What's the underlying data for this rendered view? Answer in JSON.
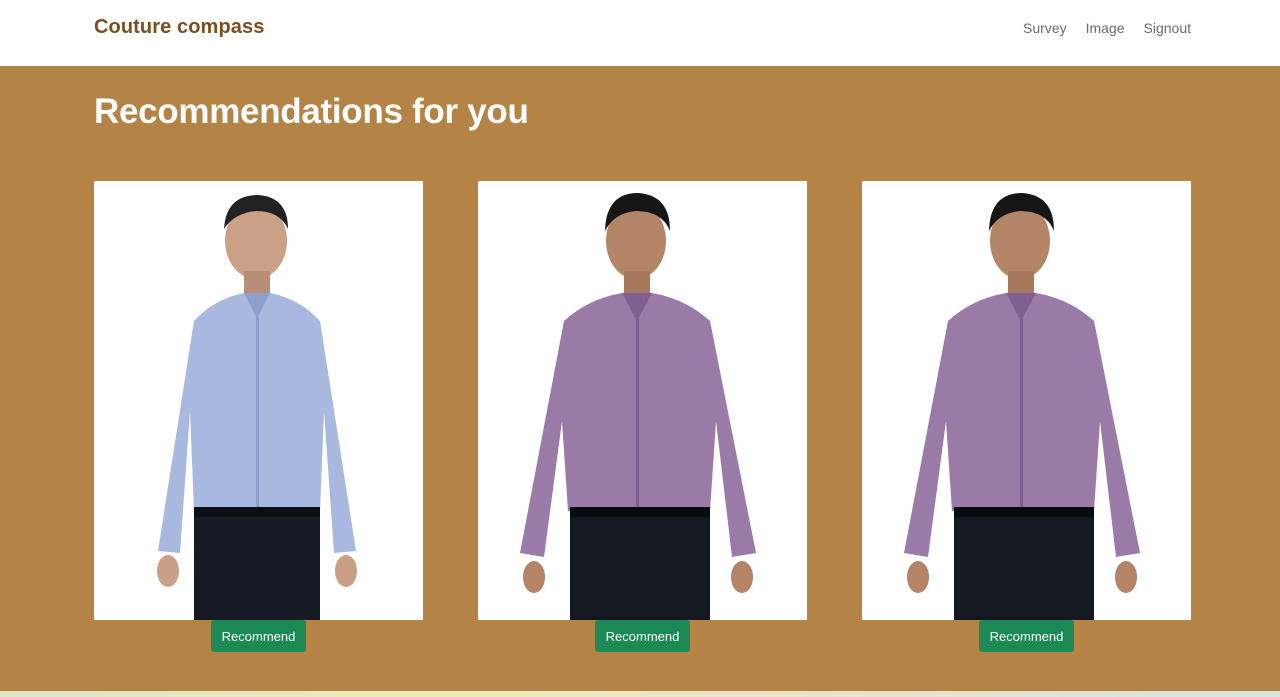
{
  "navbar": {
    "brand": "Couture compass",
    "links": [
      "Survey",
      "Image",
      "Signout"
    ]
  },
  "page": {
    "title": "Recommendations for you"
  },
  "recommendations": [
    {
      "button_label": "Recommend",
      "shirt_color": "#a9b8de",
      "shirt_shade": "#8e9fcd"
    },
    {
      "button_label": "Recommend",
      "shirt_color": "#9a7aa6",
      "shirt_shade": "#7f6090"
    },
    {
      "button_label": "Recommend",
      "shirt_color": "#9a7aa6",
      "shirt_shade": "#7f6090"
    }
  ],
  "colors": {
    "accent": "#b38446",
    "brand": "#7a4f1d",
    "button": "#1b8a55"
  }
}
